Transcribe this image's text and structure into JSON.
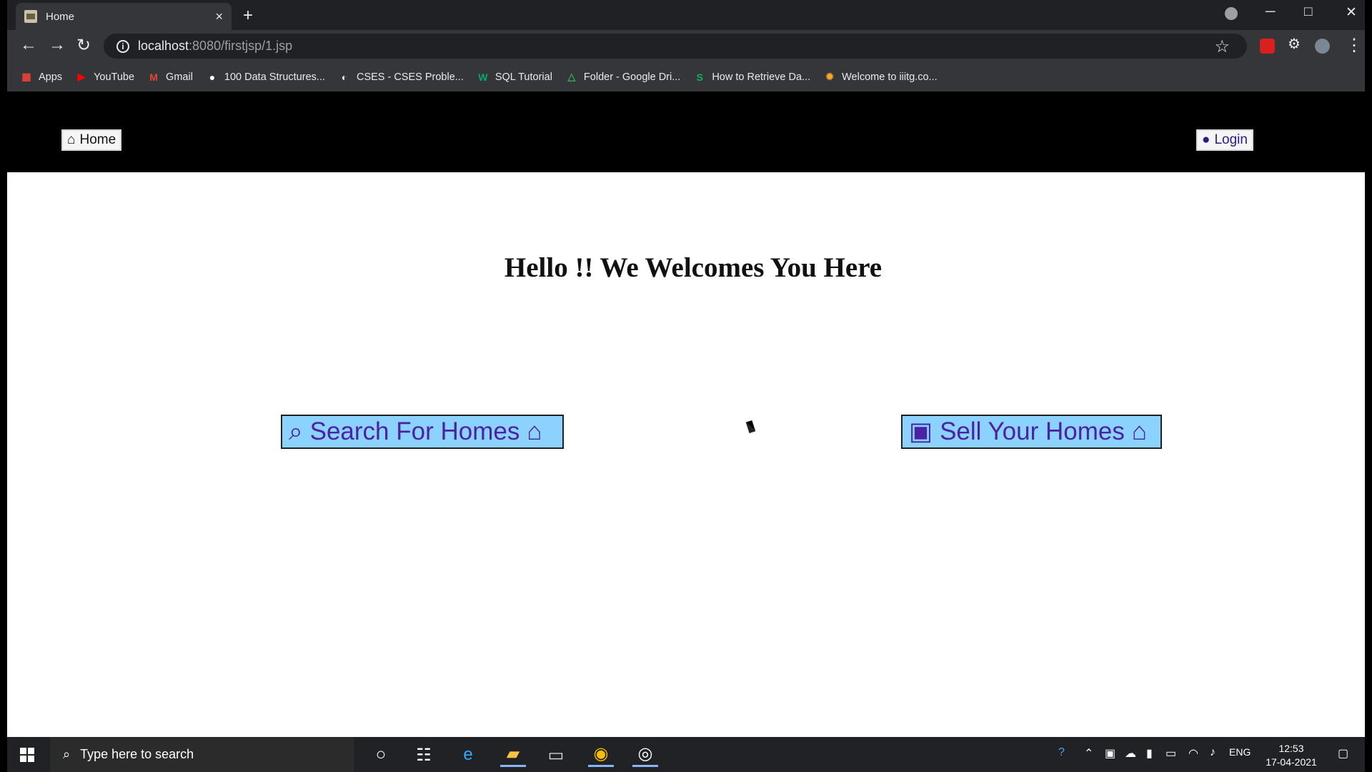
{
  "browser": {
    "tab": {
      "title": "Home",
      "close": "×",
      "favicon": "house-thumbnail"
    },
    "new_tab": "+",
    "window_controls": {
      "minimize": "─",
      "maximize": "□",
      "close": "✕"
    },
    "navigation": {
      "back": "←",
      "forward": "→",
      "reload": "↻",
      "url_host": "localhost",
      "url_path": ":8080/firstjsp/1.jsp",
      "bookmark_icon": "☆",
      "menu_icon": "⋮"
    },
    "bookmarks": [
      {
        "label": "Apps",
        "icon": "grid-icon",
        "color": "#ea4335"
      },
      {
        "label": "YouTube",
        "icon": "youtube-icon",
        "color": "#ff0000"
      },
      {
        "label": "Gmail",
        "icon": "gmail-icon",
        "color": "#ea4335"
      },
      {
        "label": "100 Data Structures...",
        "icon": "medium-icon",
        "color": "#ffffff"
      },
      {
        "label": "CSES - CSES Proble...",
        "icon": "globe-icon",
        "color": "#e8eaed"
      },
      {
        "label": "SQL Tutorial",
        "icon": "w3schools-icon",
        "color": "#04aa6d"
      },
      {
        "label": "Folder - Google Dri...",
        "icon": "drive-icon",
        "color": "#34a853"
      },
      {
        "label": "How to Retrieve Da...",
        "icon": "s-icon",
        "color": "#17b05a"
      },
      {
        "label": "Welcome to iiitg.co...",
        "icon": "settings-logo-icon",
        "color": "#f4a825"
      }
    ]
  },
  "site": {
    "nav": {
      "home_label": "Home",
      "login_label": "Login"
    },
    "headline": "Hello !! We Welcomes You Here",
    "actions": {
      "search_label": "Search For Homes",
      "sell_label": "Sell Your Homes"
    },
    "colors": {
      "action_bg": "#8bd2ff",
      "action_text": "#4b22a3"
    }
  },
  "taskbar": {
    "search_placeholder": "Type here to search",
    "language": "ENG",
    "time": "12:53",
    "date": "17-04-2021"
  }
}
